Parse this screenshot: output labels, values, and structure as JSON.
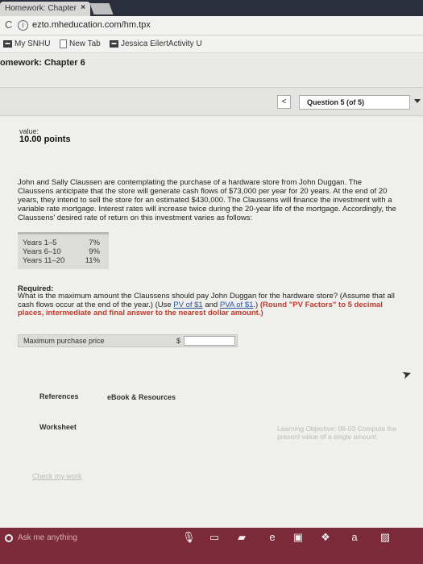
{
  "browser": {
    "tab_title": "Homework: Chapter",
    "tab_close": "×",
    "url": "ezto.mheducation.com/hm.tpx",
    "bookmarks": [
      {
        "label": "My SNHU",
        "icon": "bookmark-icon"
      },
      {
        "label": "New Tab",
        "icon": "page-icon"
      },
      {
        "label": "Jessica EilertActivity U",
        "icon": "bookmark-icon"
      }
    ]
  },
  "page": {
    "title": "omework: Chapter 6"
  },
  "nav": {
    "prev_glyph": "<",
    "question_label": "Question 5 (of 5)"
  },
  "question": {
    "value_label": "value:",
    "points": "10.00 points",
    "body": "John and Sally Claussen are contemplating the purchase of a hardware store from John Duggan. The Claussens anticipate that the store will generate cash flows of $73,000 per year for 20 years. At the end of 20 years, they intend to sell the store for an estimated $430,000. The Claussens will finance the investment with a variable rate mortgage. Interest rates will increase twice during the 20-year life of the mortgage. Accordingly, the Claussens' desired rate of return on this investment varies as follows:",
    "rates": [
      {
        "years": "Years 1–5",
        "rate": "7%"
      },
      {
        "years": "Years 6–10",
        "rate": "9%"
      },
      {
        "years": "Years 11–20",
        "rate": "11%"
      }
    ],
    "required_heading": "Required:",
    "required_text_1": "What is the maximum amount the Claussens should pay John Duggan for the hardware store? (Assume that all cash flows occur at the end of the year.) (Use ",
    "link_pv": "PV of $1",
    "required_and": " and ",
    "link_pva": "PVA of $1",
    "required_text_2": ".) ",
    "required_red": "(Round \"PV Factors\" to 5 decimal places, intermediate and final answer to the nearest dollar amount.)",
    "answer_label": "Maximum purchase price",
    "currency": "$",
    "answer_value": ""
  },
  "tabs": {
    "references": "References",
    "ebook": "eBook & Resources",
    "worksheet": "Worksheet"
  },
  "learning_objective": "Learning Objective: 08-03 Compute the present value of a single amount.",
  "check_work": "Check my work",
  "taskbar": {
    "search_placeholder": "Ask me anything",
    "icons": [
      "microphone-icon",
      "task-view-icon",
      "file-explorer-icon",
      "edge-icon",
      "store-icon",
      "dropbox-icon",
      "amazon-icon",
      "photo-icon"
    ]
  },
  "colors": {
    "taskbar": "#7c2a3a",
    "link": "#2850a0",
    "instruction_red": "#c0392b"
  }
}
